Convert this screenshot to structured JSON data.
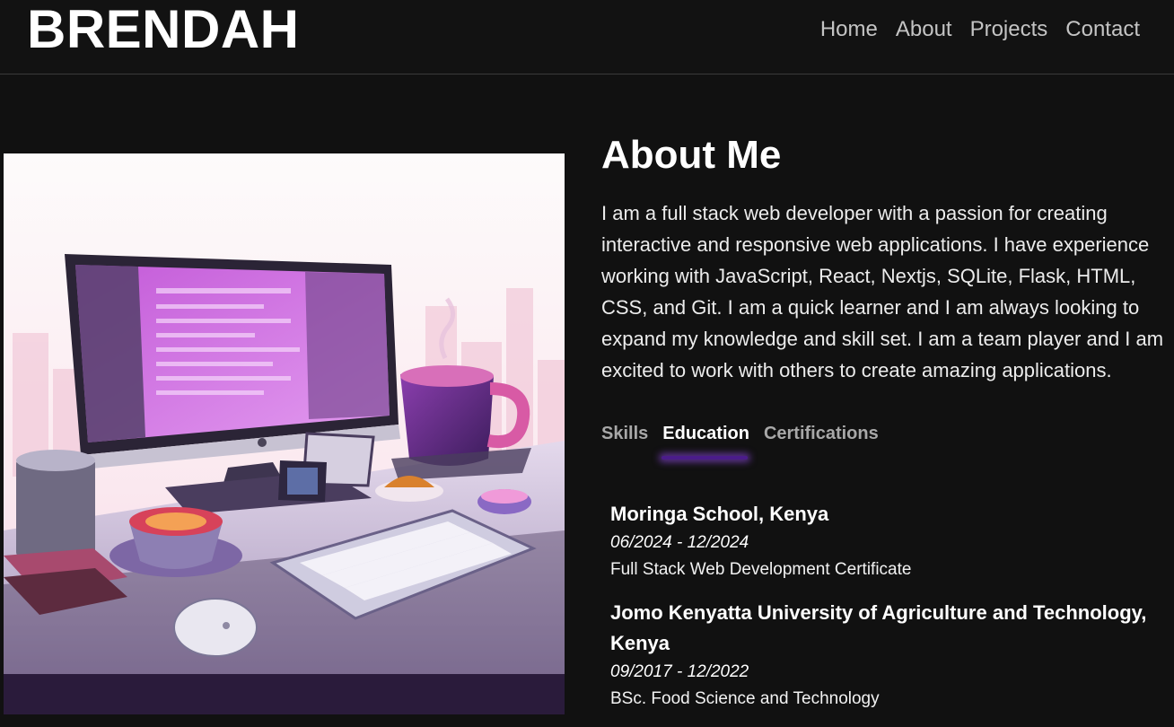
{
  "header": {
    "logo": "BRENDAH",
    "nav": [
      "Home",
      "About",
      "Projects",
      "Contact"
    ]
  },
  "about": {
    "title": "About Me",
    "text": "I am a full stack web developer with a passion for creating interactive and responsive web applications. I have experience working with JavaScript, React, Nextjs, SQLite, Flask, HTML, CSS, and Git. I am a quick learner and I am always looking to expand my knowledge and skill set. I am a team player and I am excited to work with others to create amazing applications."
  },
  "tabs": [
    {
      "label": "Skills",
      "active": false
    },
    {
      "label": "Education",
      "active": true
    },
    {
      "label": "Certifications",
      "active": false
    }
  ],
  "education": [
    {
      "school": "Moringa School, Kenya",
      "dates": "06/2024 - 12/2024",
      "degree": "Full Stack Web Development Certificate"
    },
    {
      "school": "Jomo Kenyatta University of Agriculture and Technology, Kenya",
      "dates": "09/2017 - 12/2022",
      "degree": "BSc. Food Science and Technology"
    }
  ],
  "colors": {
    "background": "#111111",
    "accent": "#4b1c8a",
    "nav_text": "#c4c4c4",
    "tab_inactive": "#a8a8a8"
  },
  "image": {
    "icon": "desk-setup-illustration"
  }
}
